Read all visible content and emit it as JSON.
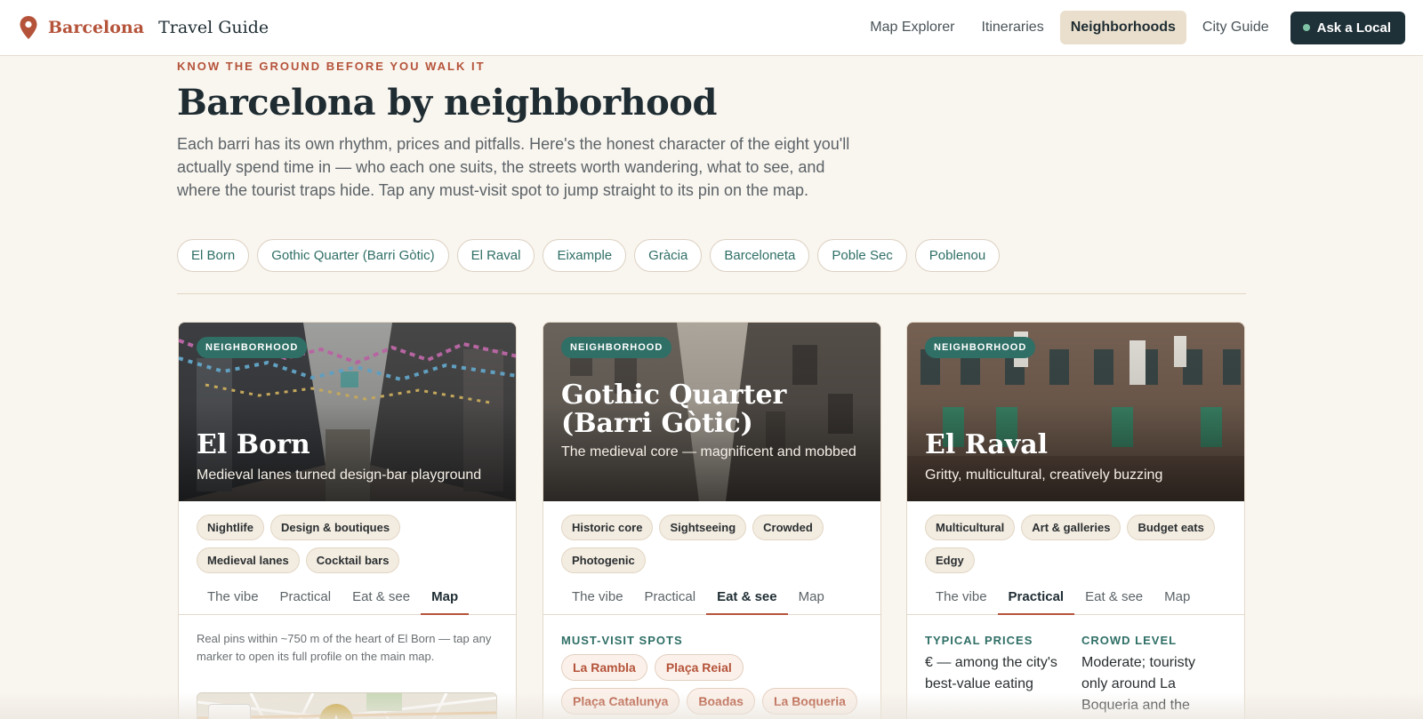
{
  "header": {
    "brand_name": "Barcelona",
    "brand_sub": "Travel Guide",
    "nav": [
      {
        "label": "Map Explorer",
        "active": false
      },
      {
        "label": "Itineraries",
        "active": false
      },
      {
        "label": "Neighborhoods",
        "active": true
      },
      {
        "label": "City Guide",
        "active": false
      }
    ],
    "cta": "Ask a Local"
  },
  "intro": {
    "eyebrow": "KNOW THE GROUND BEFORE YOU WALK IT",
    "title": "Barcelona by neighborhood",
    "lede": "Each barri has its own rhythm, prices and pitfalls. Here's the honest character of the eight you'll actually spend time in — who each one suits, the streets worth wandering, what to see, and where the tourist traps hide. Tap any must-visit spot to jump straight to its pin on the map."
  },
  "chips": [
    "El Born",
    "Gothic Quarter (Barri Gòtic)",
    "El Raval",
    "Eixample",
    "Gràcia",
    "Barceloneta",
    "Poble Sec",
    "Poblenou"
  ],
  "cards": [
    {
      "tag": "NEIGHBORHOOD",
      "title": "El Born",
      "subtitle": "Medieval lanes turned design-bar playground",
      "badges": [
        "Nightlife",
        "Design & boutiques",
        "Medieval lanes",
        "Cocktail bars"
      ],
      "tabs": [
        "The vibe",
        "Practical",
        "Eat & see",
        "Map"
      ],
      "active_tab": "Map",
      "map_note": "Real pins within ~750 m of the heart of El Born — tap any marker to open its full profile on the main map.",
      "zoom_label": "+"
    },
    {
      "tag": "NEIGHBORHOOD",
      "title": "Gothic Quarter (Barri Gòtic)",
      "subtitle": "The medieval core — magnificent and mobbed",
      "badges": [
        "Historic core",
        "Sightseeing",
        "Crowded",
        "Photogenic"
      ],
      "tabs": [
        "The vibe",
        "Practical",
        "Eat & see",
        "Map"
      ],
      "active_tab": "Eat & see",
      "section_label": "MUST-VISIT SPOTS",
      "spots": [
        "La Rambla",
        "Plaça Reial",
        "Plaça Catalunya",
        "Boadas",
        "La Boqueria"
      ]
    },
    {
      "tag": "NEIGHBORHOOD",
      "title": "El Raval",
      "subtitle": "Gritty, multicultural, creatively buzzing",
      "badges": [
        "Multicultural",
        "Art & galleries",
        "Budget eats",
        "Edgy"
      ],
      "tabs": [
        "The vibe",
        "Practical",
        "Eat & see",
        "Map"
      ],
      "active_tab": "Practical",
      "practical": [
        {
          "label": "TYPICAL PRICES",
          "value": "€ — among the city's best-value eating"
        },
        {
          "label": "CROWD LEVEL",
          "value": "Moderate; touristy only around La Boqueria and the"
        }
      ]
    }
  ],
  "colors": {
    "accent": "#b5533a",
    "teal": "#2f6f66",
    "dark": "#1f3138",
    "background": "#f9f5ef"
  }
}
